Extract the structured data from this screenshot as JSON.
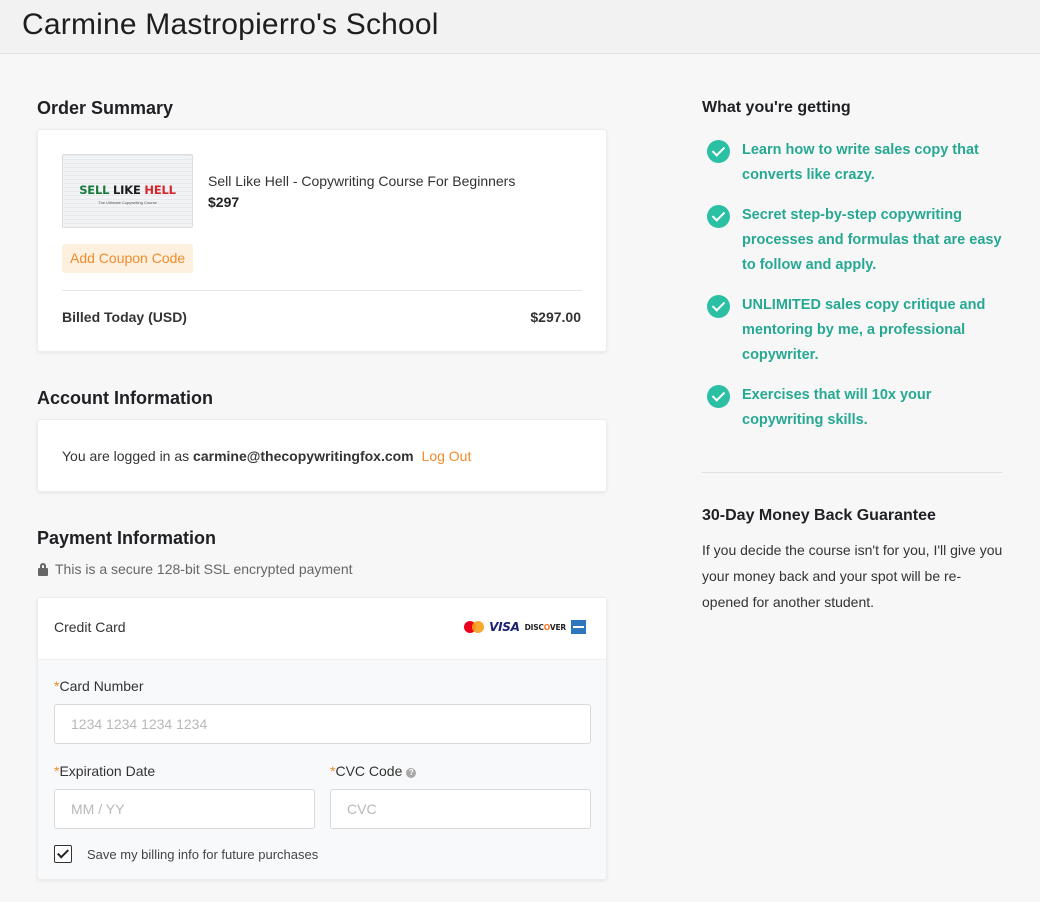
{
  "header": {
    "school_title": "Carmine Mastropierro's School"
  },
  "order_summary": {
    "title": "Order Summary",
    "product": {
      "thumb_words": [
        "SELL",
        "LIKE",
        "HELL"
      ],
      "thumb_subtitle": "The Ultimate Copywriting Course",
      "name": "Sell Like Hell - Copywriting Course For Beginners",
      "price": "$297"
    },
    "coupon_label": "Add Coupon Code",
    "billed_label": "Billed Today (USD)",
    "billed_amount": "$297.00"
  },
  "account": {
    "title": "Account Information",
    "logged_in_prefix": "You are logged in as",
    "email": "carmine@thecopywritingfox.com",
    "logout_label": "Log Out"
  },
  "payment": {
    "title": "Payment Information",
    "secure_note": "This is a secure 128-bit SSL encrypted payment",
    "method_label": "Credit Card",
    "card_brands": {
      "visa": "VISA",
      "discover_prefix": "DISC",
      "discover_o": "O",
      "discover_suffix": "VER"
    },
    "required_mark": "*",
    "card_number_label": "Card Number",
    "card_number_placeholder": "1234 1234 1234 1234",
    "expiration_label": "Expiration Date",
    "expiration_placeholder": "MM / YY",
    "cvc_label": "CVC Code",
    "cvc_placeholder": "CVC",
    "help_glyph": "?",
    "save_info_label": "Save my billing info for future purchases",
    "save_info_checked": true
  },
  "benefits": {
    "title": "What you're getting",
    "items": [
      "Learn how to write sales copy that converts like crazy.",
      "Secret step-by-step copywriting processes and formulas that are easy to follow and apply.",
      "UNLIMITED sales copy critique and mentoring by me, a professional copywriter.",
      "Exercises that will 10x your copywriting skills."
    ]
  },
  "guarantee": {
    "title": "30-Day Money Back Guarantee",
    "text": "If you decide the course isn't for you, I'll give you your money back and your spot will be re-opened for another student."
  },
  "colors": {
    "accent_orange": "#f08b2b",
    "accent_teal": "#2bbfa4",
    "teal_text": "#26a892"
  }
}
